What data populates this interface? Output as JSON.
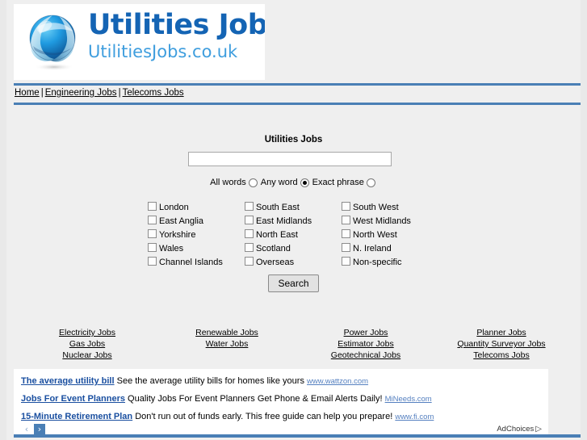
{
  "site": {
    "logo_title": "Utilities Jobs",
    "logo_subtitle": "UtilitiesJobs.co.uk",
    "logo_icon": "globe-icon"
  },
  "nav": {
    "items": [
      {
        "label": "Home"
      },
      {
        "label": "Engineering Jobs"
      },
      {
        "label": "Telecoms Jobs"
      }
    ],
    "separator": "|"
  },
  "search": {
    "heading": "Utilities Jobs",
    "input_value": "",
    "input_placeholder": "",
    "button_label": "Search",
    "match_modes": [
      {
        "label": "All words",
        "checked": false
      },
      {
        "label": "Any word",
        "checked": true
      },
      {
        "label": "Exact phrase",
        "checked": false
      }
    ]
  },
  "regions": {
    "columns": [
      [
        {
          "label": "London",
          "checked": false
        },
        {
          "label": "East Anglia",
          "checked": false
        },
        {
          "label": "Yorkshire",
          "checked": false
        },
        {
          "label": "Wales",
          "checked": false
        },
        {
          "label": "Channel Islands",
          "checked": false
        }
      ],
      [
        {
          "label": "South East",
          "checked": false
        },
        {
          "label": "East Midlands",
          "checked": false
        },
        {
          "label": "North East",
          "checked": false
        },
        {
          "label": "Scotland",
          "checked": false
        },
        {
          "label": "Overseas",
          "checked": false
        }
      ],
      [
        {
          "label": "South West",
          "checked": false
        },
        {
          "label": "West Midlands",
          "checked": false
        },
        {
          "label": "North West",
          "checked": false
        },
        {
          "label": "N. Ireland",
          "checked": false
        },
        {
          "label": "Non-specific",
          "checked": false
        }
      ]
    ]
  },
  "job_links": {
    "columns": [
      [
        {
          "label": "Electricity Jobs"
        },
        {
          "label": "Gas Jobs"
        },
        {
          "label": "Nuclear Jobs"
        }
      ],
      [
        {
          "label": "Renewable Jobs"
        },
        {
          "label": "Water Jobs"
        }
      ],
      [
        {
          "label": "Power Jobs"
        },
        {
          "label": "Estimator Jobs"
        },
        {
          "label": "Geotechnical Jobs"
        }
      ],
      [
        {
          "label": "Planner Jobs"
        },
        {
          "label": "Quantity Surveyor Jobs"
        },
        {
          "label": "Telecoms Jobs"
        }
      ]
    ]
  },
  "ads": {
    "items": [
      {
        "title": "The average utility bill",
        "description": "See the average utility bills for homes like yours",
        "url": "www.wattzon.com"
      },
      {
        "title": "Jobs For Event Planners",
        "description": "Quality Jobs For Event Planners Get Phone & Email Alerts Daily!",
        "url": "MiNeeds.com"
      },
      {
        "title": "15-Minute Retirement Plan",
        "description": "Don't run out of funds early. This free guide can help you prepare!",
        "url": "www.fi.com"
      }
    ],
    "prev_arrow": "‹",
    "next_arrow": "›",
    "adchoices_label": "AdChoices",
    "adchoices_glyph": "▷"
  },
  "colors": {
    "brand_blue": "#1464b4",
    "brand_light_blue": "#3f9ede",
    "rule_blue": "#4a7fb5",
    "ad_title": "#1a4fa0",
    "ad_url": "#5580c0",
    "page_bg": "#efefef"
  }
}
